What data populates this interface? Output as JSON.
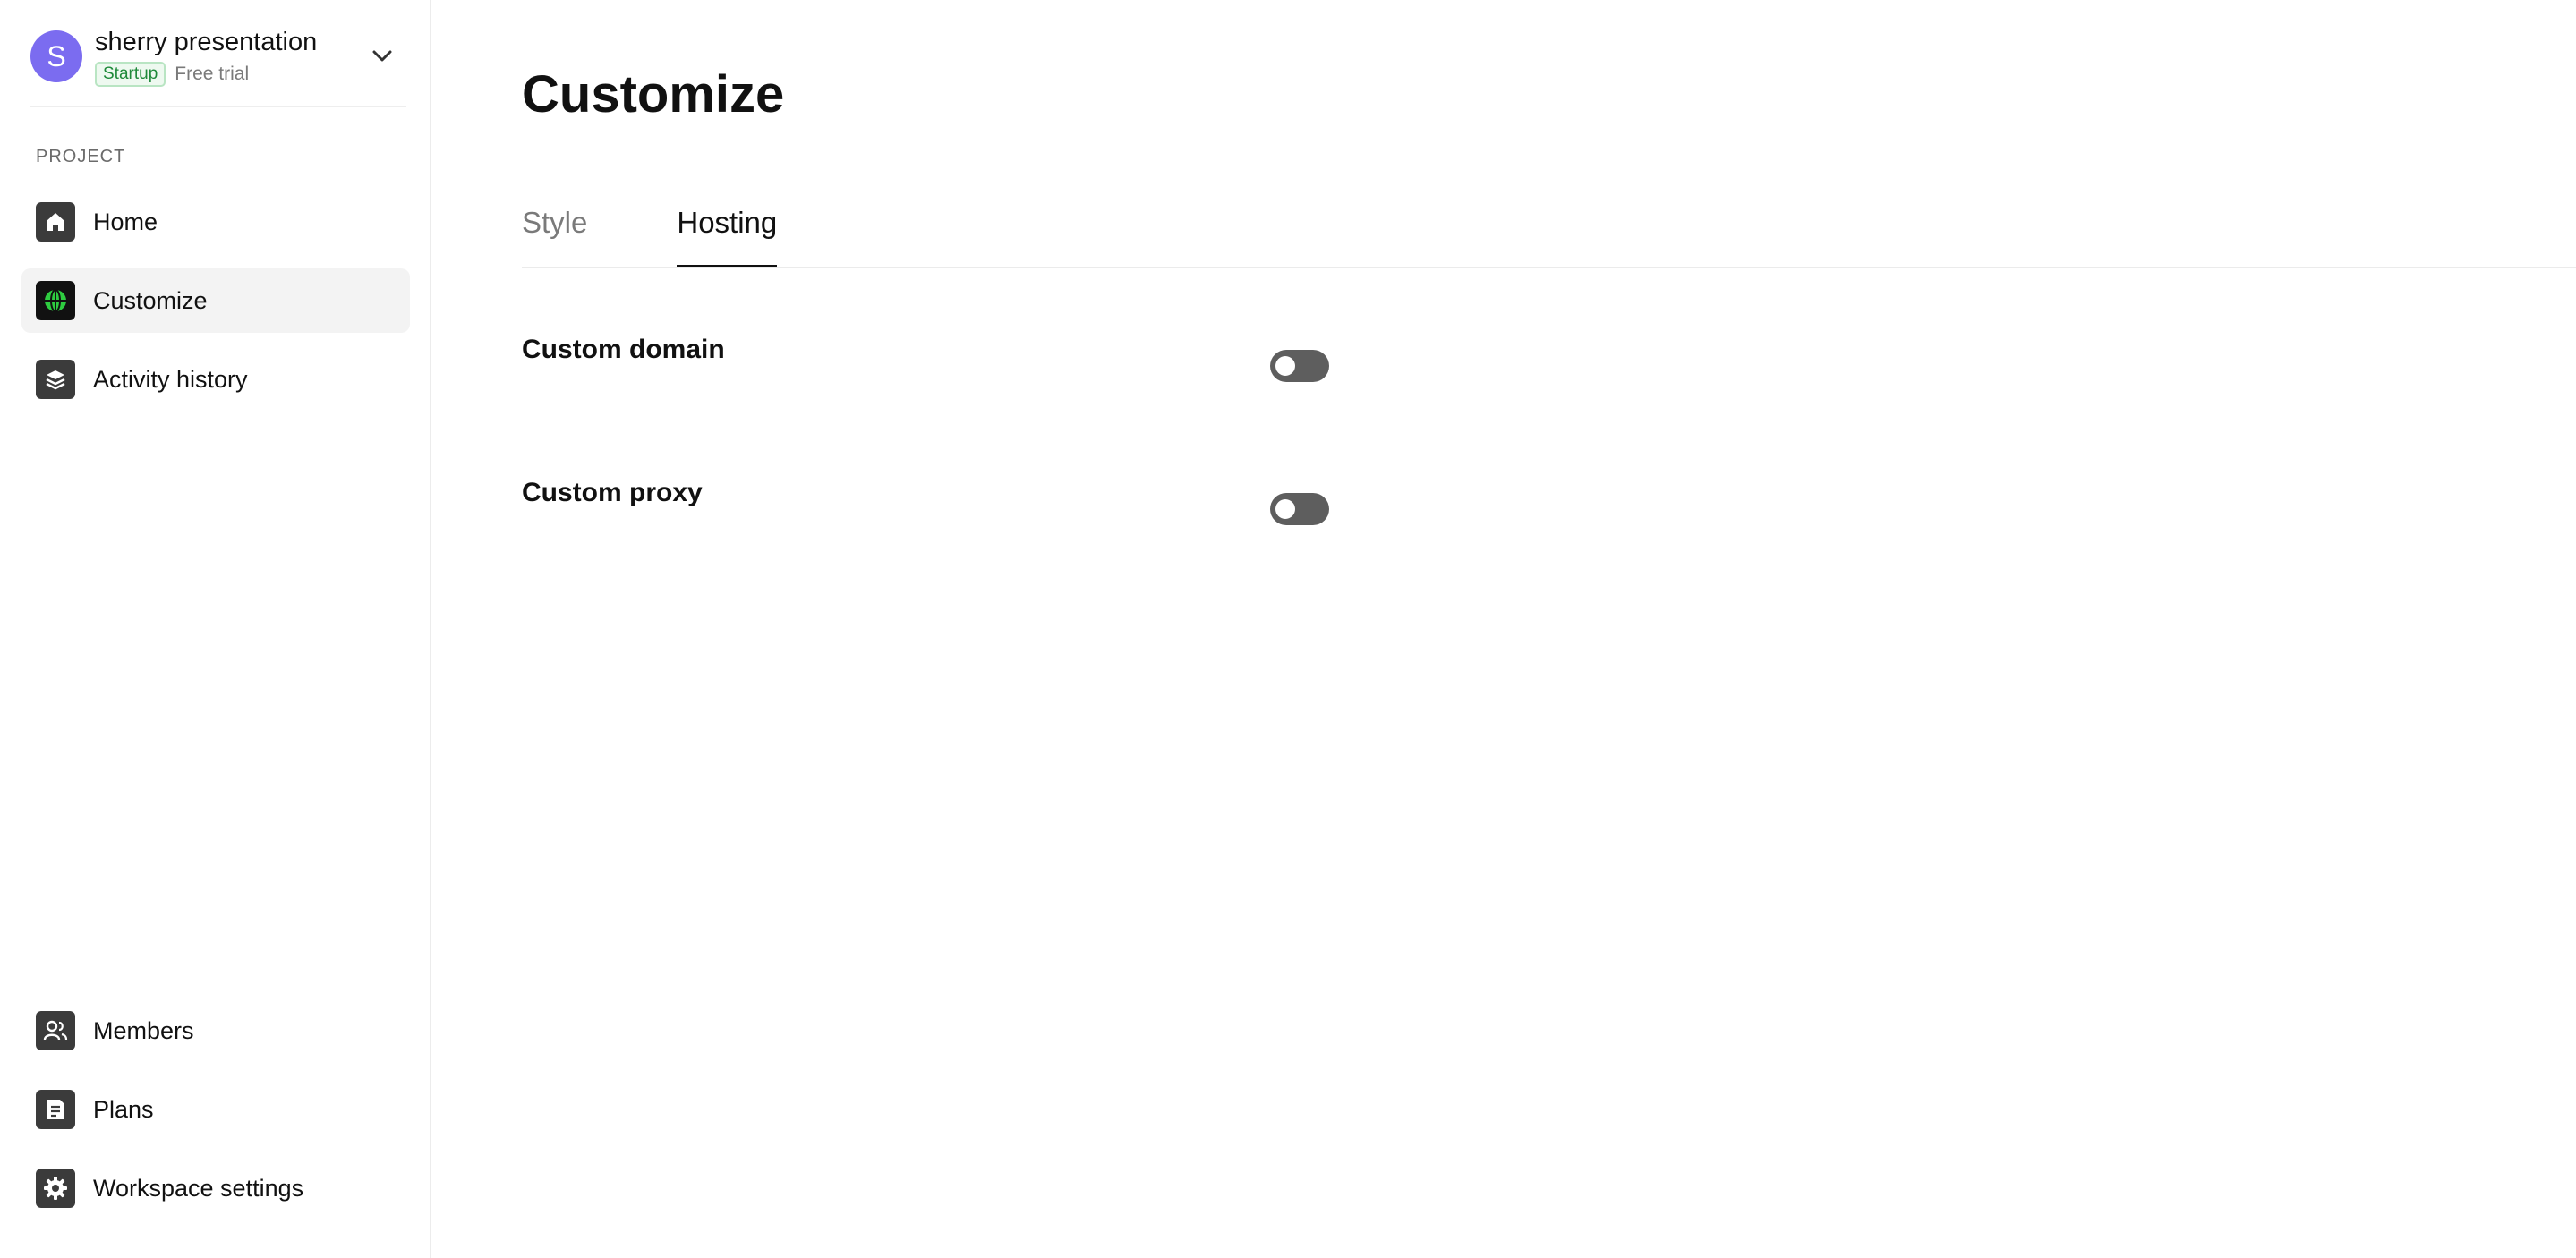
{
  "workspace": {
    "avatar_letter": "S",
    "name": "sherry presentation",
    "plan_badge": "Startup",
    "trial_label": "Free trial"
  },
  "sidebar": {
    "section_label": "PROJECT",
    "items": [
      {
        "label": "Home",
        "icon": "home-icon",
        "active": false
      },
      {
        "label": "Customize",
        "icon": "globe-icon",
        "active": true
      },
      {
        "label": "Activity history",
        "icon": "layers-icon",
        "active": false
      }
    ],
    "bottom_items": [
      {
        "label": "Members",
        "icon": "members-icon"
      },
      {
        "label": "Plans",
        "icon": "document-icon"
      },
      {
        "label": "Workspace settings",
        "icon": "gear-icon"
      }
    ]
  },
  "main": {
    "title": "Customize",
    "tabs": [
      {
        "label": "Style",
        "active": false
      },
      {
        "label": "Hosting",
        "active": true
      }
    ],
    "settings": [
      {
        "label": "Custom domain",
        "enabled": false
      },
      {
        "label": "Custom proxy",
        "enabled": false
      }
    ]
  },
  "colors": {
    "accent_avatar": "#7b6cf0",
    "badge_green": "#1f8a3a",
    "globe_green": "#2ecc40",
    "toggle_off": "#5e5e5e"
  }
}
